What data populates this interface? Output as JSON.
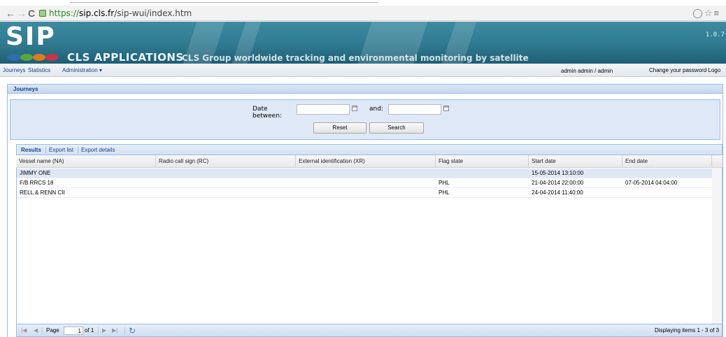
{
  "browser": {
    "scheme": "https://",
    "host": "sip.cls.fr",
    "path": "/sip-wui/index.htm",
    "back_icon": "back-arrow-icon",
    "forward_icon": "forward-arrow-icon",
    "reload_icon": "reload-icon",
    "lock_icon": "lock-icon"
  },
  "banner": {
    "logo": "SIP",
    "apps_title": "CLS APPLICATIONS",
    "tagline": "CLS Group worldwide tracking and environmental monitoring by satellite",
    "version": "1.0.7",
    "colors": {
      "banner": "#2f7a90",
      "accent": "#15428b"
    }
  },
  "menubar": {
    "items": [
      "Journeys",
      "Statistics",
      "Administration ▾"
    ],
    "user": "admin admin  /  admin",
    "change_password": "Change your password",
    "logout": "Logo"
  },
  "panel": {
    "title": "Journeys"
  },
  "filter": {
    "date_label_1": "Date",
    "date_label_2": "between:",
    "and_label": "and:",
    "from_value": "",
    "to_value": "",
    "reset_label": "Reset",
    "search_label": "Search"
  },
  "results": {
    "tabs": [
      "Results",
      "Export list",
      "Export details"
    ],
    "columns": [
      "Vessel name (NA)",
      "Radio call sign (RC)",
      "External identification (XR)",
      "Flag state",
      "Start date",
      "End date"
    ],
    "rows": [
      [
        "JIMMY ONE",
        "",
        "",
        "",
        "15-05-2014 13:10:00",
        ""
      ],
      [
        "F/B RRCS 18",
        "",
        "",
        "PHL",
        "21-04-2014 22:00:00",
        "07-05-2014 04:04:00"
      ],
      [
        "RELL & RENN CII",
        "",
        "",
        "PHL",
        "24-04-2014 11:40:00",
        ""
      ]
    ]
  },
  "pager": {
    "page_label": "Page",
    "page_value": "1",
    "of_label": "of 1",
    "display": "Displaying items 1 - 3 of 3"
  }
}
